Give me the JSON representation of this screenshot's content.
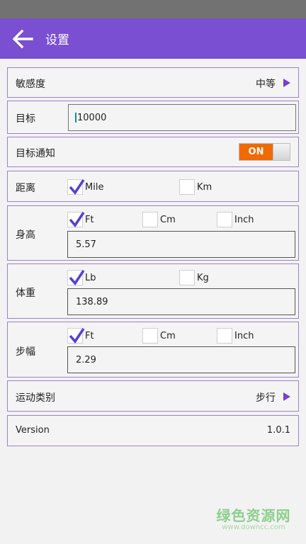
{
  "app_bar": {
    "title": "设置"
  },
  "sensitivity": {
    "label": "敏感度",
    "value": "中等"
  },
  "target": {
    "label": "目标",
    "value": "10000"
  },
  "notify": {
    "label": "目标通知",
    "toggle": "ON",
    "state": true
  },
  "distance": {
    "label": "距离",
    "options": [
      {
        "label": "Mile",
        "checked": true
      },
      {
        "label": "Km",
        "checked": false
      }
    ]
  },
  "height": {
    "label": "身高",
    "options": [
      {
        "label": "Ft",
        "checked": true
      },
      {
        "label": "Cm",
        "checked": false
      },
      {
        "label": "Inch",
        "checked": false
      }
    ],
    "value": "5.57"
  },
  "weight": {
    "label": "体重",
    "options": [
      {
        "label": "Lb",
        "checked": true
      },
      {
        "label": "Kg",
        "checked": false
      }
    ],
    "value": "138.89"
  },
  "stride": {
    "label": "步幅",
    "options": [
      {
        "label": "Ft",
        "checked": true
      },
      {
        "label": "Cm",
        "checked": false
      },
      {
        "label": "Inch",
        "checked": false
      }
    ],
    "value": "2.29"
  },
  "sport": {
    "label": "运动类别",
    "value": "步行"
  },
  "version": {
    "label": "Version",
    "value": "1.0.1"
  },
  "watermark": {
    "title": "绿色资源网",
    "url": "www.downcc.com"
  },
  "colors": {
    "accent": "#7a4fd1",
    "toggle_on": "#ef6a00",
    "check": "#5a3fd1"
  }
}
